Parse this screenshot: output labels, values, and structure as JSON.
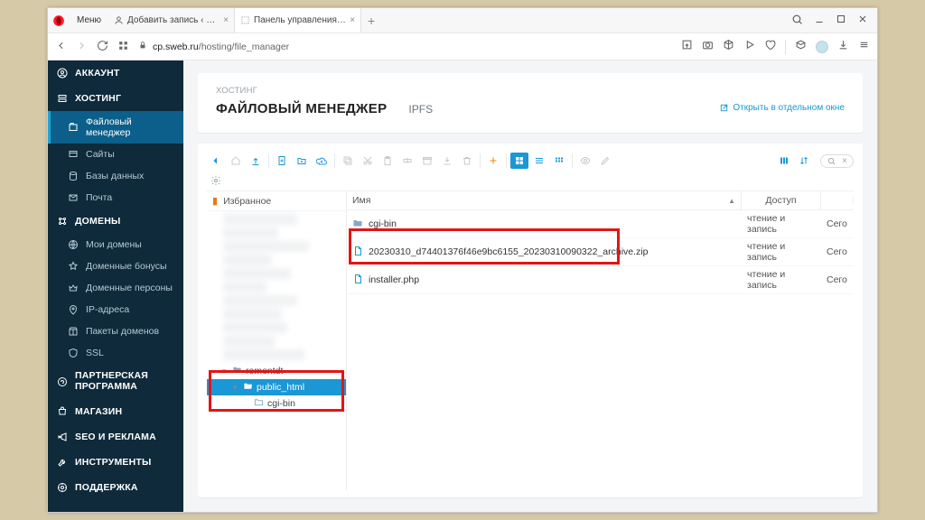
{
  "browser": {
    "menu": "Меню",
    "tabs": [
      {
        "title": "Добавить запись ‹ Админ…",
        "active": false
      },
      {
        "title": "Панель управления VH",
        "active": true
      }
    ],
    "url_host": "cp.sweb.ru",
    "url_path": "/hosting/file_manager"
  },
  "sidebar": {
    "groups": [
      {
        "label": "АККАУНТ",
        "icon": "user-circle-icon",
        "items": []
      },
      {
        "label": "ХОСТИНГ",
        "icon": "server-icon",
        "items": [
          {
            "label": "Файловый менеджер",
            "icon": "folder-icon",
            "active": true
          },
          {
            "label": "Сайты",
            "icon": "sites-icon"
          },
          {
            "label": "Базы данных",
            "icon": "database-icon"
          },
          {
            "label": "Почта",
            "icon": "mail-icon"
          }
        ]
      },
      {
        "label": "ДОМЕНЫ",
        "icon": "domains-icon",
        "items": [
          {
            "label": "Мои домены",
            "icon": "globe-icon"
          },
          {
            "label": "Доменные бонусы",
            "icon": "star-icon"
          },
          {
            "label": "Доменные персоны",
            "icon": "crown-icon"
          },
          {
            "label": "IP-адреса",
            "icon": "pin-icon"
          },
          {
            "label": "Пакеты доменов",
            "icon": "package-icon"
          },
          {
            "label": "SSL",
            "icon": "shield-icon"
          }
        ]
      },
      {
        "label": "ПАРТНЕРСКАЯ ПРОГРАММА",
        "icon": "partner-icon",
        "items": []
      },
      {
        "label": "МАГАЗИН",
        "icon": "cart-icon",
        "items": []
      },
      {
        "label": "SEO И РЕКЛАМА",
        "icon": "megaphone-icon",
        "items": []
      },
      {
        "label": "ИНСТРУМЕНТЫ",
        "icon": "wrench-icon",
        "items": []
      },
      {
        "label": "ПОДДЕРЖКА",
        "icon": "support-icon",
        "items": []
      }
    ]
  },
  "header": {
    "breadcrumb": "ХОСТИНГ",
    "title": "ФАЙЛОВЫЙ МЕНЕДЖЕР",
    "tab2": "IPFS",
    "open_external": "Открыть в отдельном окне"
  },
  "tree": {
    "favorites": "Избранное",
    "nodes": {
      "root": "remontdt",
      "public_html": "public_html",
      "cgibin": "cgi-bin"
    }
  },
  "list": {
    "cols": {
      "name": "Имя",
      "access": "Доступ",
      "date": ""
    },
    "rows": [
      {
        "name": "cgi-bin",
        "type": "folder",
        "access": "чтение и запись",
        "date": "Сего"
      },
      {
        "name": "20230310_d74401376f46e9bc6155_20230310090322_archive.zip",
        "type": "file",
        "access": "чтение и запись",
        "date": "Сего"
      },
      {
        "name": "installer.php",
        "type": "file",
        "access": "чтение и запись",
        "date": "Сего"
      }
    ]
  }
}
